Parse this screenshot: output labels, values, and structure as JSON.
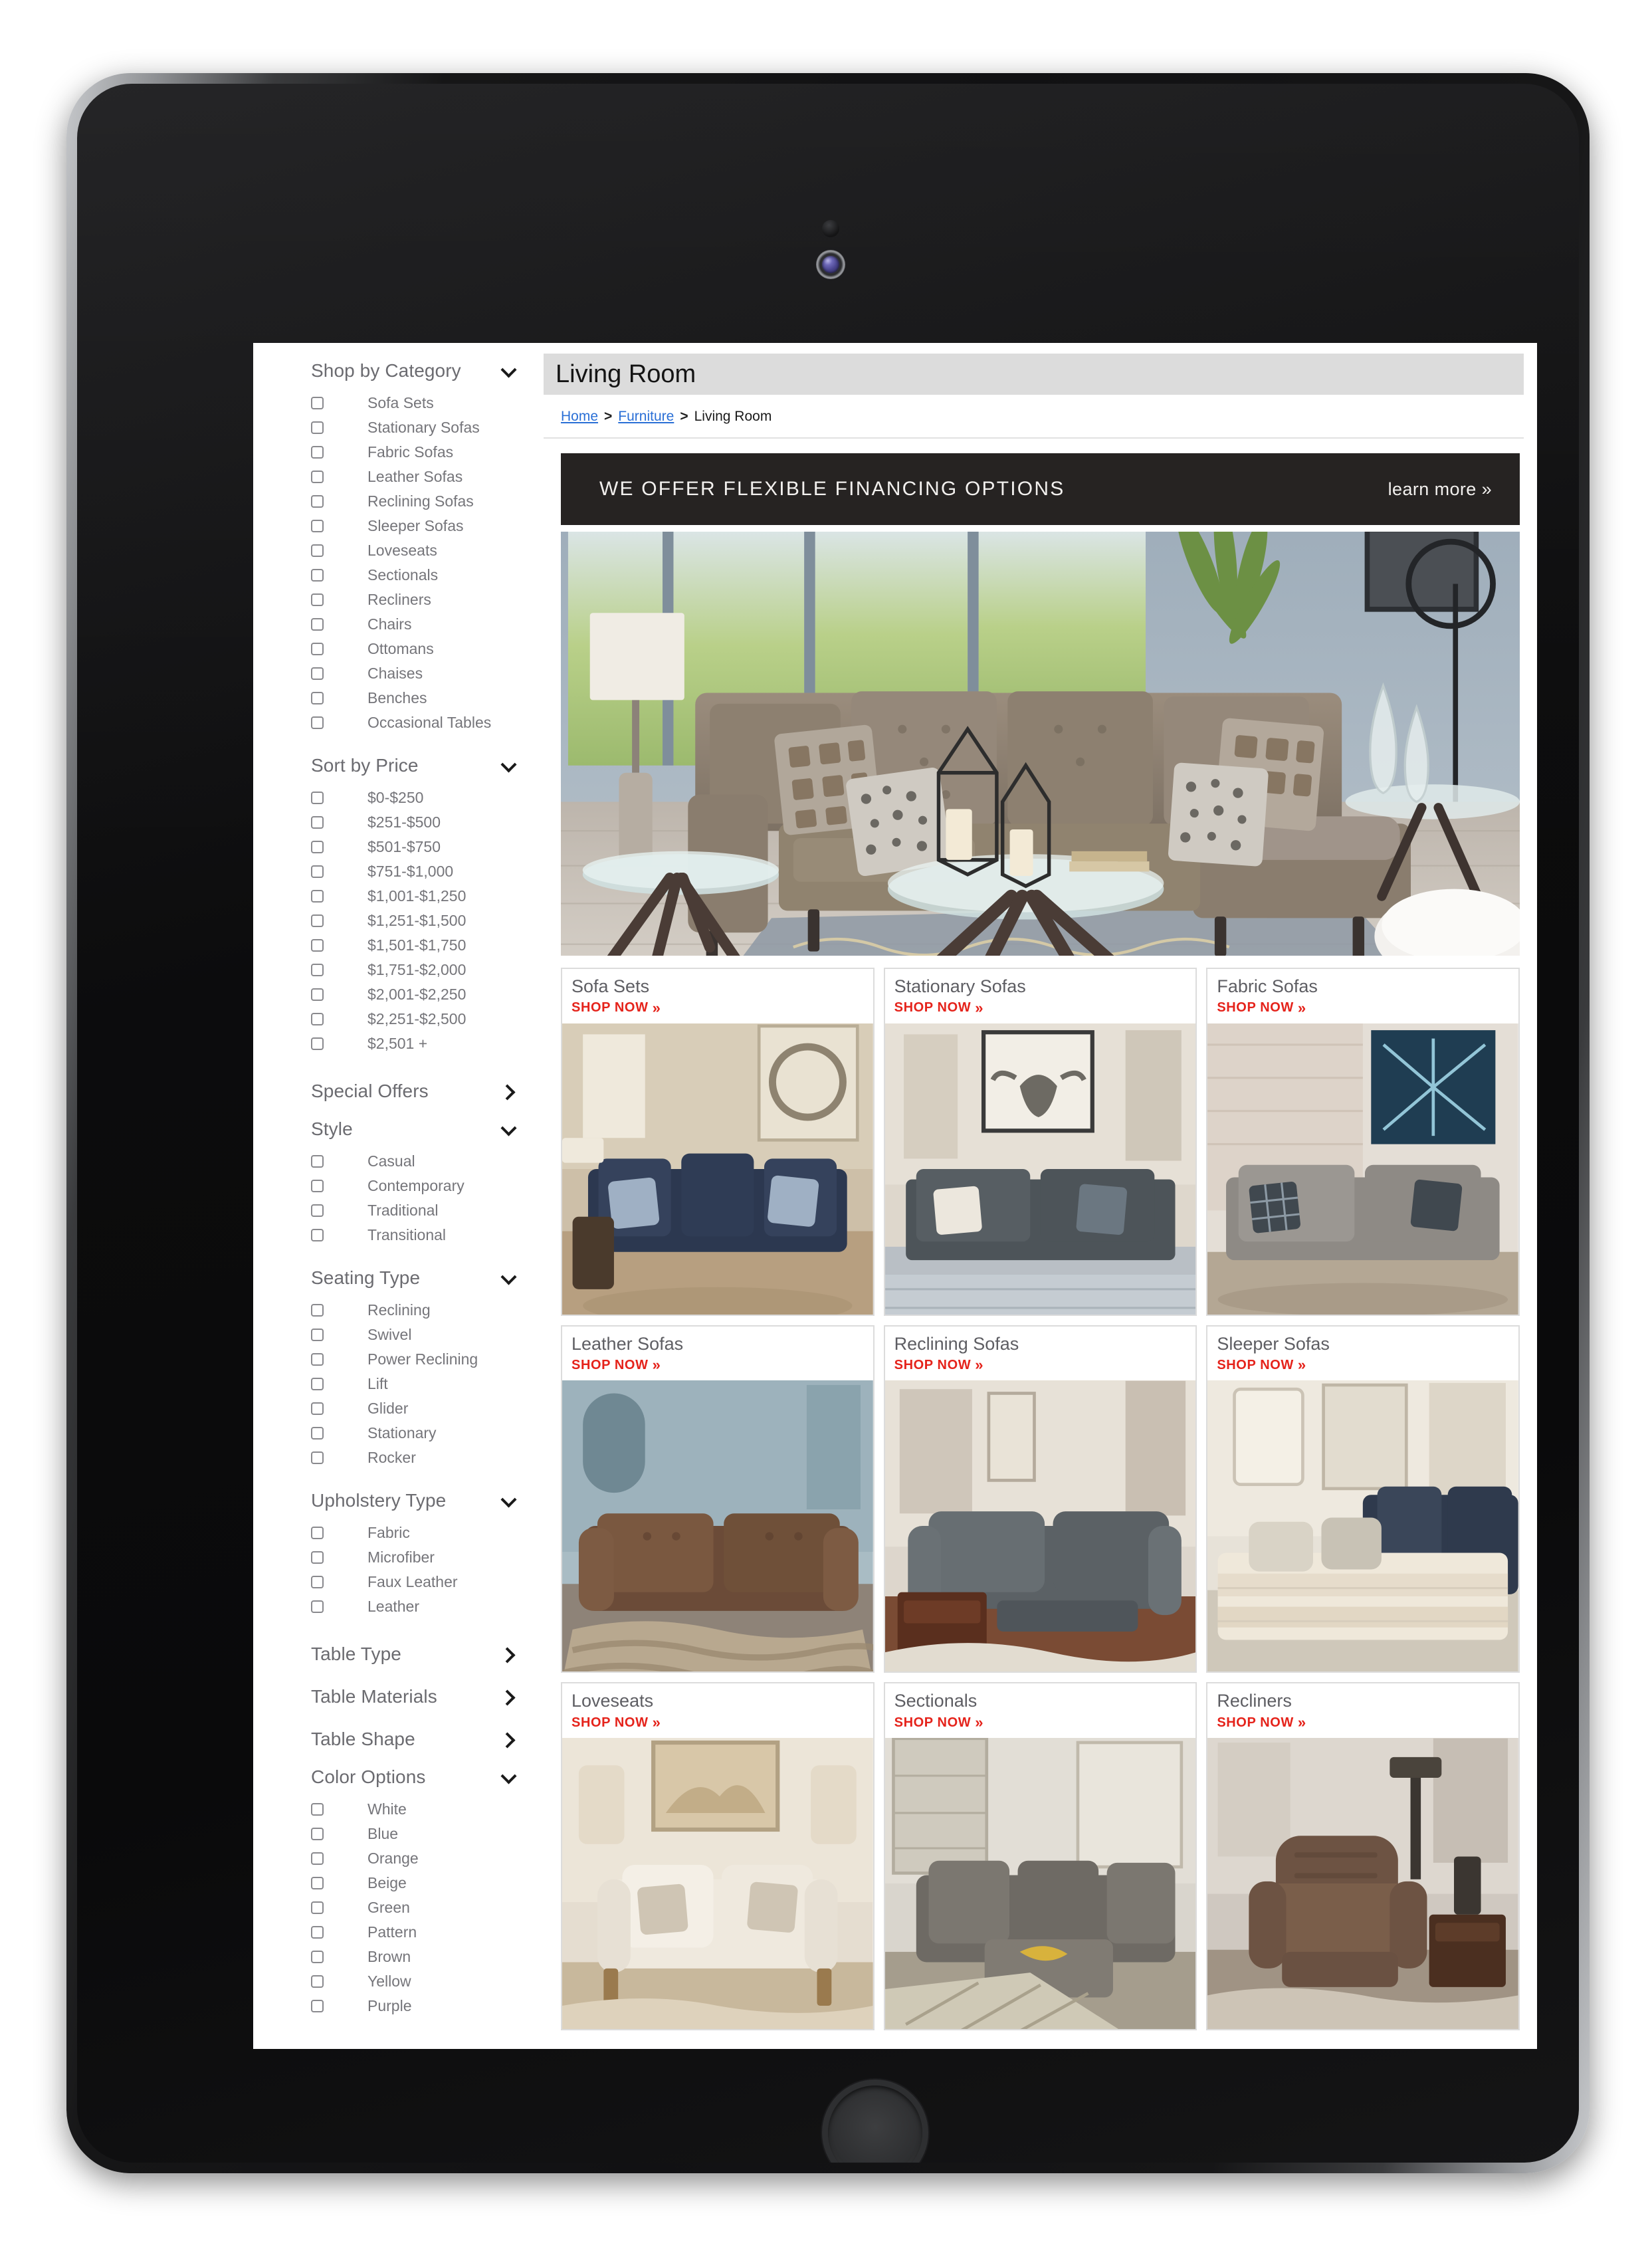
{
  "device": {
    "type": "tablet",
    "sensor_icon": "proximity-sensor-icon",
    "camera_icon": "front-camera-icon",
    "home_button_label": "Home"
  },
  "page": {
    "title": "Living Room"
  },
  "breadcrumb": {
    "items": [
      {
        "label": "Home",
        "is_link": true
      },
      {
        "label": "Furniture",
        "is_link": true
      },
      {
        "label": "Living Room",
        "is_link": false
      }
    ],
    "separator": ">"
  },
  "banner": {
    "headline": "WE OFFER FLEXIBLE FINANCING OPTIONS",
    "cta": "learn more »",
    "background": "#262322",
    "text_color": "#f2f0ee"
  },
  "hero": {
    "alt": "Brown tufted sectional sofa with chaise, patterned pillows, glass end tables and geometric candle holders in a blue-grey living room"
  },
  "sidebar": {
    "groups": [
      {
        "title": "Shop by Category",
        "state": "expanded",
        "icon": "chevron-down-icon",
        "items": [
          "Sofa Sets",
          "Stationary Sofas",
          "Fabric Sofas",
          "Leather Sofas",
          "Reclining Sofas",
          "Sleeper Sofas",
          "Loveseats",
          "Sectionals",
          "Recliners",
          "Chairs",
          "Ottomans",
          "Chaises",
          "Benches",
          "Occasional Tables"
        ]
      },
      {
        "title": "Sort by Price",
        "state": "expanded",
        "icon": "chevron-down-icon",
        "items": [
          "$0-$250",
          "$251-$500",
          "$501-$750",
          "$751-$1,000",
          "$1,001-$1,250",
          "$1,251-$1,500",
          "$1,501-$1,750",
          "$1,751-$2,000",
          "$2,001-$2,250",
          "$2,251-$2,500",
          "$2,501 +"
        ]
      },
      {
        "title": "Special Offers",
        "state": "collapsed",
        "icon": "chevron-right-icon",
        "items": []
      },
      {
        "title": "Style",
        "state": "expanded",
        "icon": "chevron-down-icon",
        "items": [
          "Casual",
          "Contemporary",
          "Traditional",
          "Transitional"
        ]
      },
      {
        "title": "Seating Type",
        "state": "expanded",
        "icon": "chevron-down-icon",
        "items": [
          "Reclining",
          "Swivel",
          "Power Reclining",
          "Lift",
          "Glider",
          "Stationary",
          "Rocker"
        ]
      },
      {
        "title": "Upholstery Type",
        "state": "expanded",
        "icon": "chevron-down-icon",
        "items": [
          "Fabric",
          "Microfiber",
          "Faux Leather",
          "Leather"
        ]
      },
      {
        "title": "Table Type",
        "state": "collapsed",
        "icon": "chevron-right-icon",
        "items": []
      },
      {
        "title": "Table Materials",
        "state": "collapsed",
        "icon": "chevron-right-icon",
        "items": []
      },
      {
        "title": "Table Shape",
        "state": "collapsed",
        "icon": "chevron-right-icon",
        "items": []
      },
      {
        "title": "Color Options",
        "state": "expanded",
        "icon": "chevron-down-icon",
        "items": [
          "White",
          "Blue",
          "Orange",
          "Beige",
          "Green",
          "Pattern",
          "Brown",
          "Yellow",
          "Purple"
        ]
      }
    ]
  },
  "products": {
    "shop_now_label": "SHOP NOW",
    "shop_now_icon": "double-chevron-right-icon",
    "accent_color": "#e5231b",
    "cards": [
      {
        "name": "Sofa Sets",
        "image_alt": "Navy blue sofa set with patterned pillows in a warm beige living room"
      },
      {
        "name": "Stationary Sofas",
        "image_alt": "Dark grey stationary sofa with cream and plaid pillows under a bull-skull wall art"
      },
      {
        "name": "Fabric Sofas",
        "image_alt": "Grey fabric sofa with plaid pillows and abstract blue artwork on a brick wall"
      },
      {
        "name": "Leather Sofas",
        "image_alt": "Brown leather sofa on a shaggy patterned rug in a blue room"
      },
      {
        "name": "Reclining Sofas",
        "image_alt": "Grey reclining sofa with footrest extended beside a wood end table"
      },
      {
        "name": "Sleeper Sofas",
        "image_alt": "Navy sleeper sofa opened into a bed with cream blankets"
      },
      {
        "name": "Loveseats",
        "image_alt": "Cream loveseat with rolled arms and nailhead trim under framed art"
      },
      {
        "name": "Sectionals",
        "image_alt": "Grey sectional with ottoman and yellow throw in a bright room"
      },
      {
        "name": "Recliners",
        "image_alt": "Brown faux-leather power recliner next to a wood side table and lamp"
      }
    ]
  }
}
